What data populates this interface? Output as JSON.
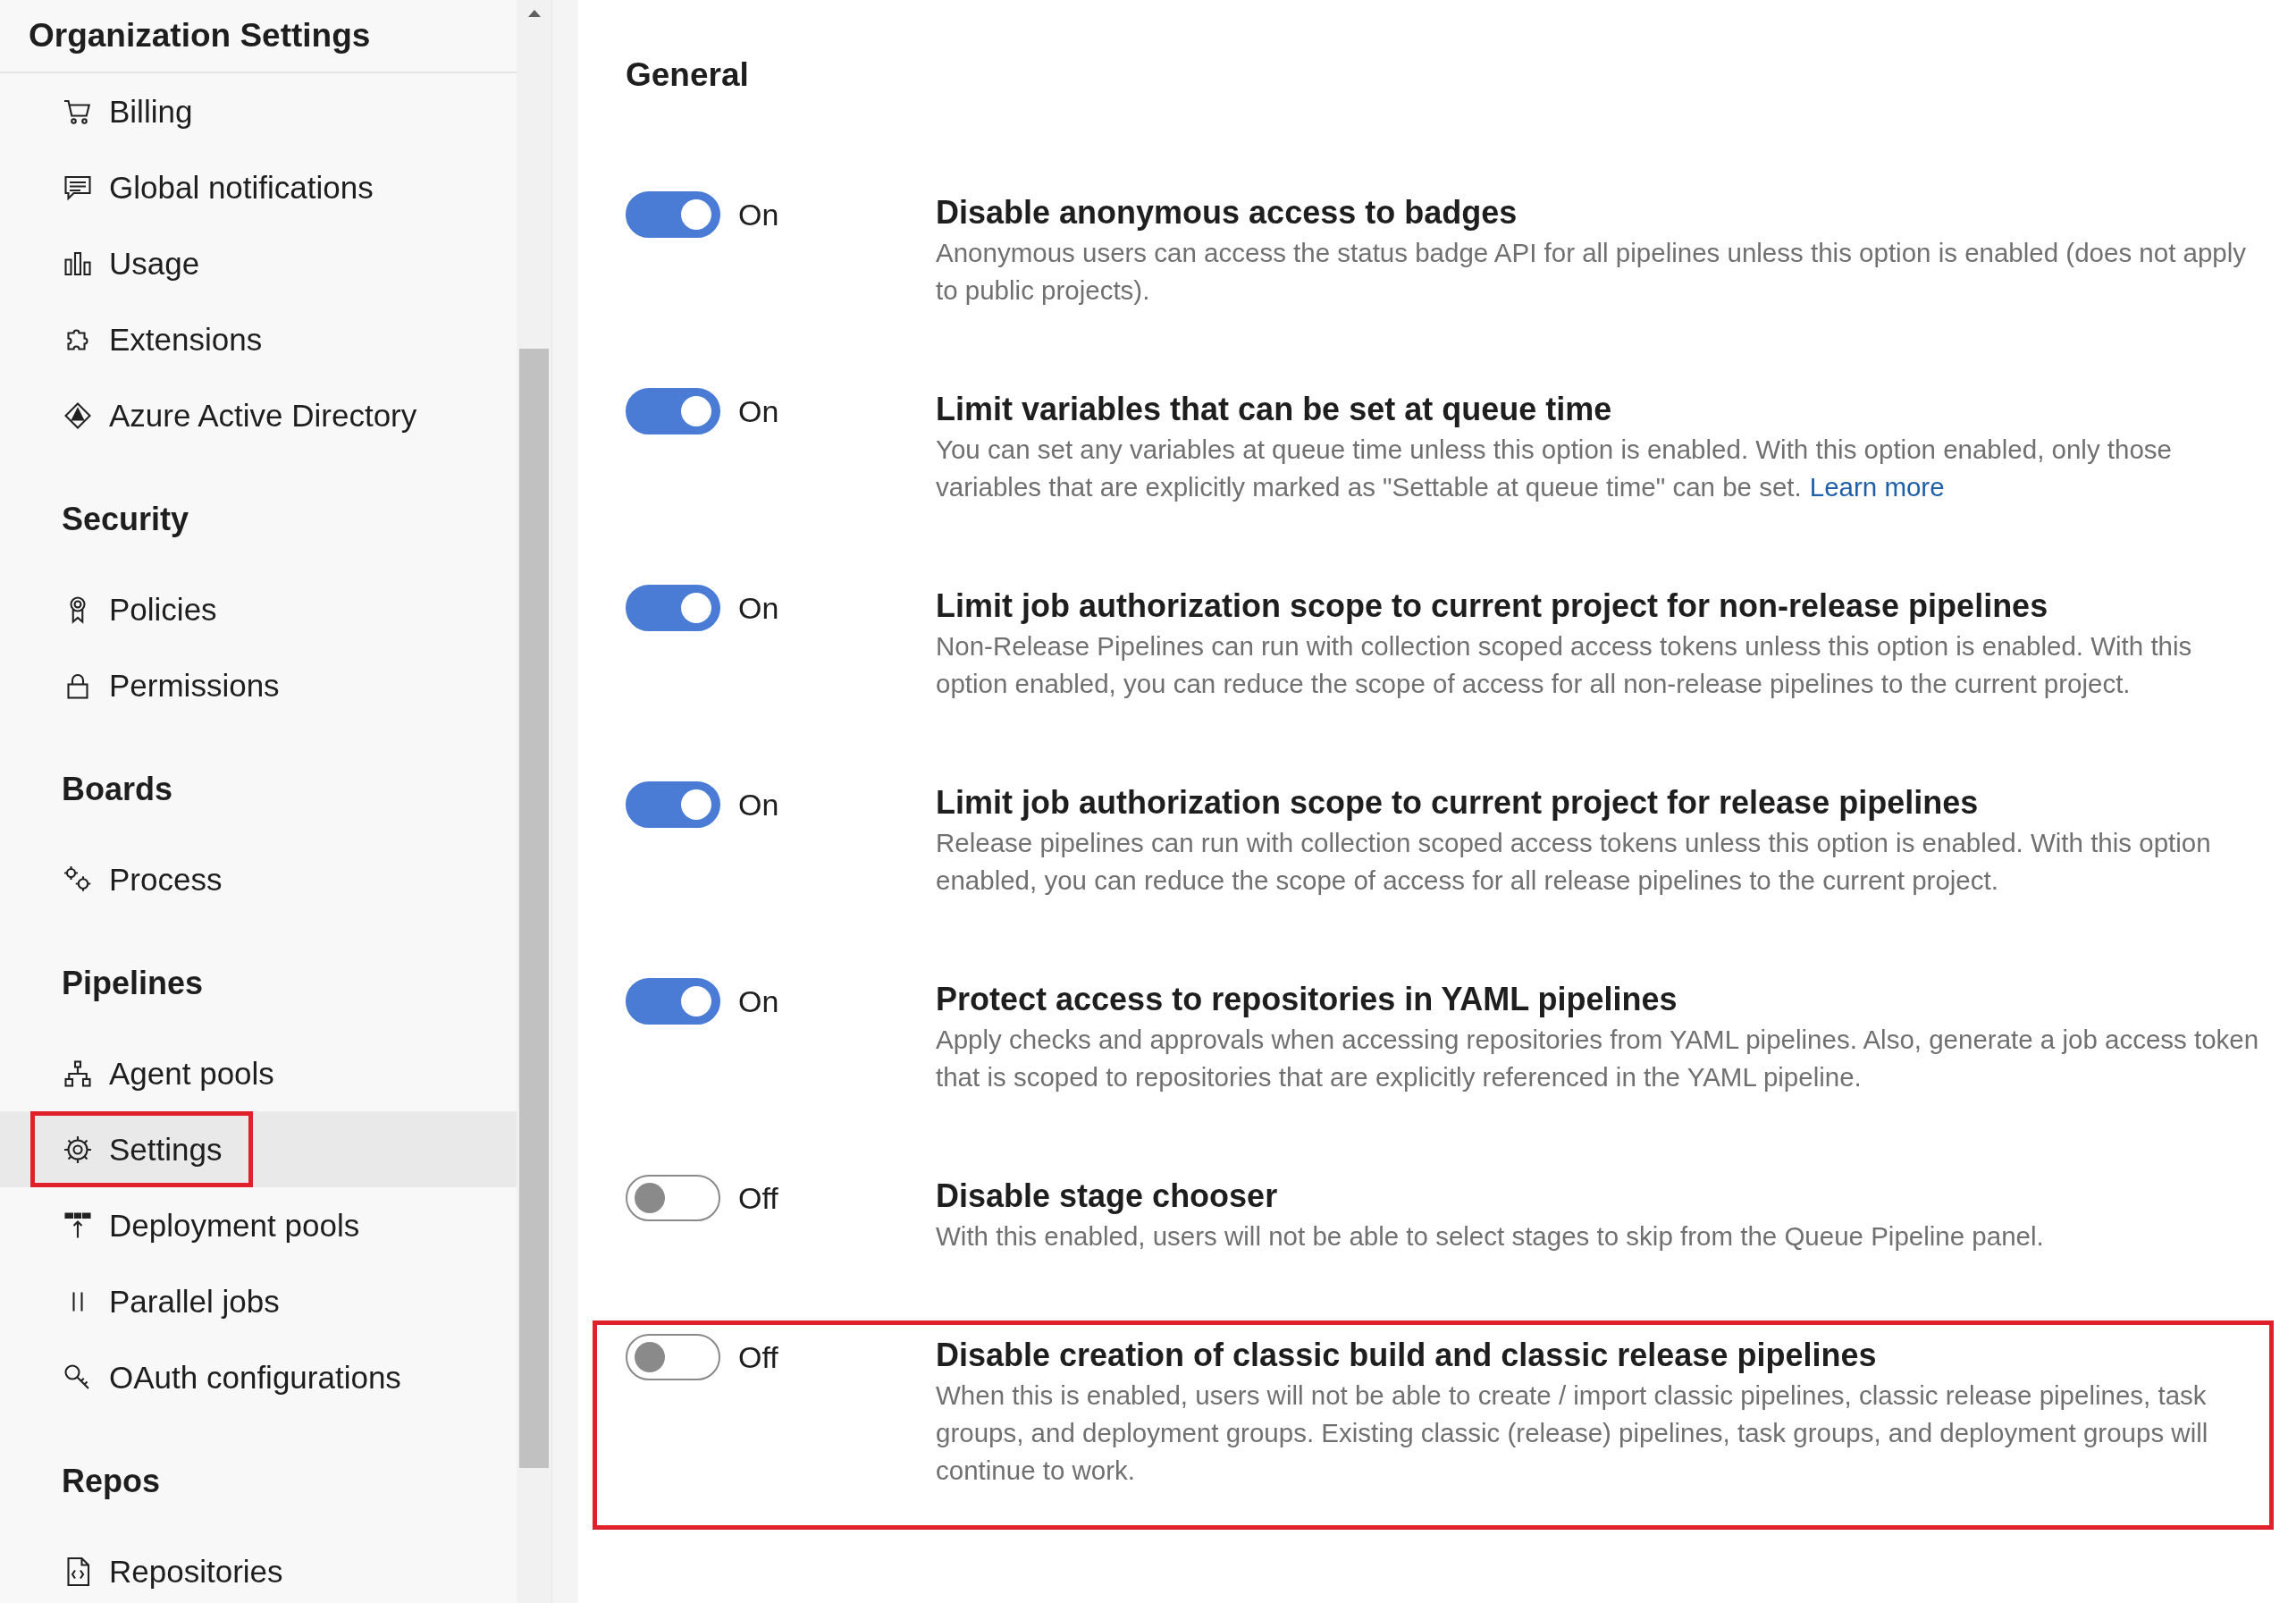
{
  "sidebar": {
    "title": "Organization Settings",
    "sections": [
      {
        "items": [
          {
            "label": "Billing",
            "selected": false,
            "highlighted": false
          },
          {
            "label": "Global notifications",
            "selected": false,
            "highlighted": false
          },
          {
            "label": "Usage",
            "selected": false,
            "highlighted": false
          },
          {
            "label": "Extensions",
            "selected": false,
            "highlighted": false
          },
          {
            "label": "Azure Active Directory",
            "selected": false,
            "highlighted": false
          }
        ]
      },
      {
        "title": "Security",
        "items": [
          {
            "label": "Policies",
            "selected": false,
            "highlighted": false
          },
          {
            "label": "Permissions",
            "selected": false,
            "highlighted": false
          }
        ]
      },
      {
        "title": "Boards",
        "items": [
          {
            "label": "Process",
            "selected": false,
            "highlighted": false
          }
        ]
      },
      {
        "title": "Pipelines",
        "items": [
          {
            "label": "Agent pools",
            "selected": false,
            "highlighted": false
          },
          {
            "label": "Settings",
            "selected": true,
            "highlighted": true
          },
          {
            "label": "Deployment pools",
            "selected": false,
            "highlighted": false
          },
          {
            "label": "Parallel jobs",
            "selected": false,
            "highlighted": false
          },
          {
            "label": "OAuth configurations",
            "selected": false,
            "highlighted": false
          }
        ]
      },
      {
        "title": "Repos",
        "items": [
          {
            "label": "Repositories",
            "selected": false,
            "highlighted": false
          }
        ]
      }
    ]
  },
  "main": {
    "heading": "General",
    "settings": [
      {
        "on": true,
        "state_label": "On",
        "title": "Disable anonymous access to badges",
        "description": "Anonymous users can access the status badge API for all pipelines unless this option is enabled (does not apply to public projects).",
        "highlighted": false
      },
      {
        "on": true,
        "state_label": "On",
        "title": "Limit variables that can be set at queue time",
        "description": "You can set any variables at queue time unless this option is enabled. With this option enabled, only those variables that are explicitly marked as \"Settable at queue time\" can be set.",
        "link": "Learn more",
        "highlighted": false
      },
      {
        "on": true,
        "state_label": "On",
        "title": "Limit job authorization scope to current project for non-release pipelines",
        "description": "Non-Release Pipelines can run with collection scoped access tokens unless this option is enabled. With this option enabled, you can reduce the scope of access for all non-release pipelines to the current project.",
        "highlighted": false
      },
      {
        "on": true,
        "state_label": "On",
        "title": "Limit job authorization scope to current project for release pipelines",
        "description": "Release pipelines can run with collection scoped access tokens unless this option is enabled. With this option enabled, you can reduce the scope of access for all release pipelines to the current project.",
        "highlighted": false
      },
      {
        "on": true,
        "state_label": "On",
        "title": "Protect access to repositories in YAML pipelines",
        "description": "Apply checks and approvals when accessing repositories from YAML pipelines. Also, generate a job access token that is scoped to repositories that are explicitly referenced in the YAML pipeline.",
        "highlighted": false
      },
      {
        "on": false,
        "state_label": "Off",
        "title": "Disable stage chooser",
        "description": "With this enabled, users will not be able to select stages to skip from the Queue Pipeline panel.",
        "highlighted": false
      },
      {
        "on": false,
        "state_label": "Off",
        "title": "Disable creation of classic build and classic release pipelines",
        "description": "When this is enabled, users will not be able to create / import classic pipelines, classic release pipelines, task groups, and deployment groups. Existing classic (release) pipelines, task groups, and deployment groups will continue to work.",
        "highlighted": true
      }
    ]
  }
}
